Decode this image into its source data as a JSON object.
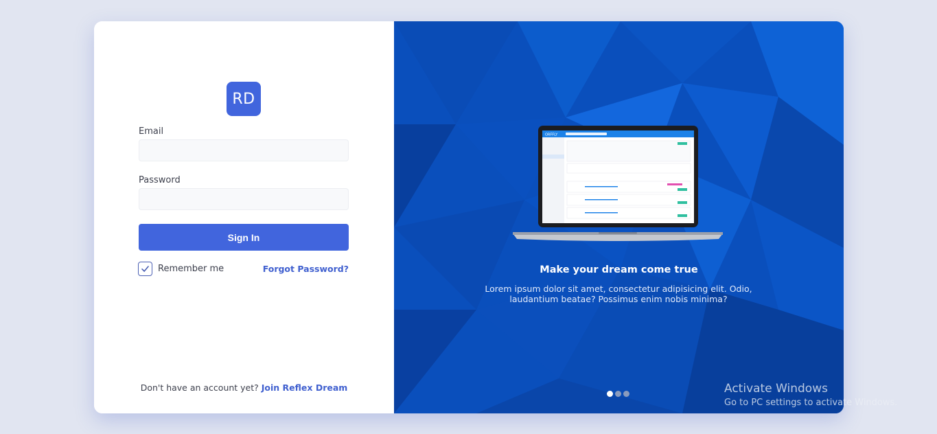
{
  "logo": {
    "text": "RD"
  },
  "form": {
    "email_label": "Email",
    "email_value": "",
    "password_label": "Password",
    "password_value": "",
    "sign_in_label": "Sign In",
    "remember_label": "Remember me",
    "remember_checked": true,
    "forgot_label": "Forgot Password?"
  },
  "signup": {
    "prompt": "Don't have an account yet?",
    "link": "Join Reflex Dream"
  },
  "promo": {
    "headline": "Make your dream come true",
    "description": "Lorem ipsum dolor sit amet, consectetur adipisicing elit. Odio, laudantium beatae? Possimus enim nobis minima?",
    "slides": 3,
    "active_slide": 0,
    "screen_brand": "ORFFLY"
  },
  "watermark": {
    "line1": "Activate Windows",
    "line2": "Go to PC settings to activate Windows."
  },
  "colors": {
    "page_bg": "#e1e5f1",
    "accent": "#4165dd",
    "link": "#3f5fcf",
    "promo_bg": "#0a4fbc"
  }
}
